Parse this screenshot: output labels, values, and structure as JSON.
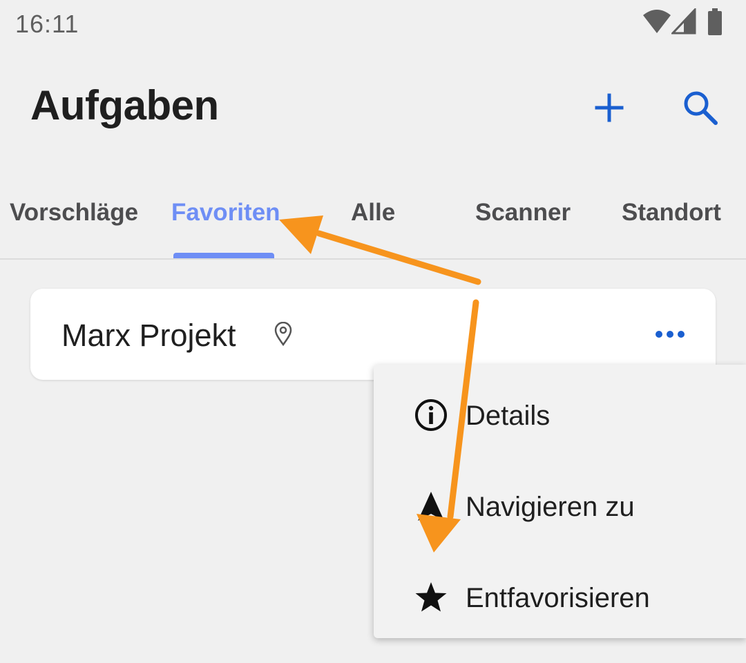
{
  "status_bar": {
    "time": "16:11",
    "icons": [
      "wifi-icon",
      "cellular-signal-icon",
      "battery-icon"
    ]
  },
  "header": {
    "title": "Aufgaben",
    "actions": [
      {
        "icon": "plus-icon",
        "color": "#1a5fd0"
      },
      {
        "icon": "search-icon",
        "color": "#1a5fd0"
      }
    ]
  },
  "tabs": [
    {
      "label": "Vorschläge",
      "active": false
    },
    {
      "label": "Favoriten",
      "active": true
    },
    {
      "label": "Alle",
      "active": false
    },
    {
      "label": "Scanner",
      "active": false
    },
    {
      "label": "Standort",
      "active": false
    }
  ],
  "favorites": [
    {
      "title": "Marx Projekt",
      "icon": "location-pin-icon",
      "more_icon": "more-horizontal-icon"
    }
  ],
  "context_menu": {
    "items": [
      {
        "label": "Details",
        "icon": "info-icon"
      },
      {
        "label": "Navigieren zu",
        "icon": "navigation-icon"
      },
      {
        "label": "Entfavorisieren",
        "icon": "star-icon"
      }
    ]
  },
  "colors": {
    "accent": "#6e8ef5",
    "action_blue": "#1a5fd0",
    "annotation_arrow": "#f7941d",
    "background": "#f0f0f0"
  }
}
